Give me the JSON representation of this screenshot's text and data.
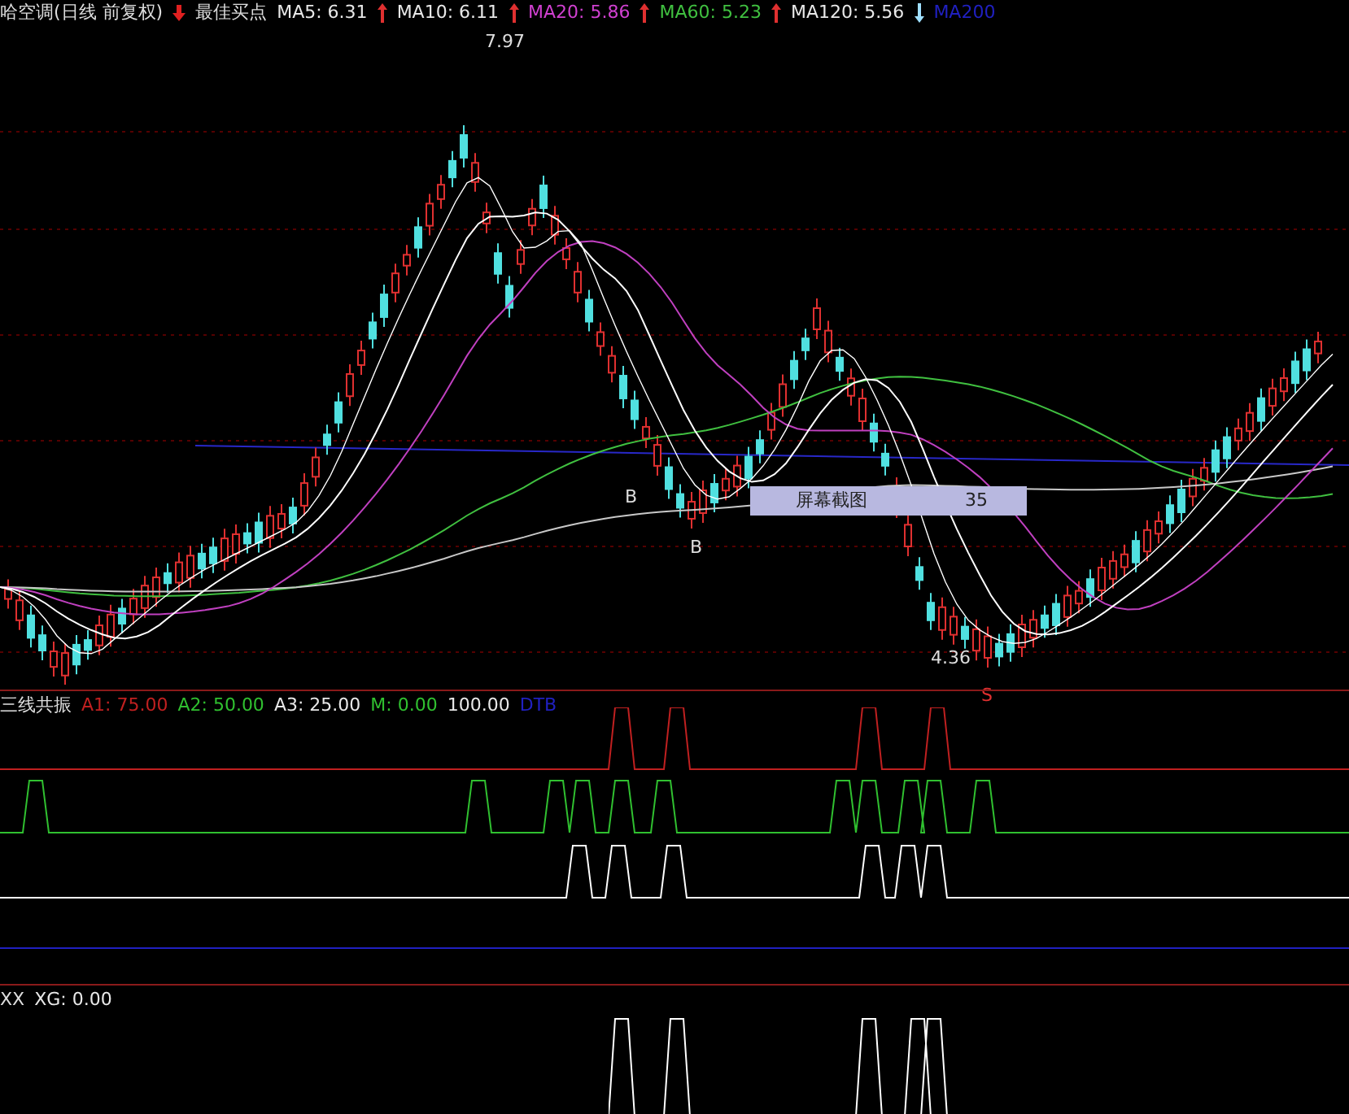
{
  "header": {
    "title": "哈空调(日线 前复权)",
    "signal_label": "最佳买点",
    "indicators": [
      {
        "label": "MA5: 6.31",
        "color": "#e8e8e8",
        "kind": "up"
      },
      {
        "label": "MA10: 6.11",
        "color": "#e8e8e8",
        "kind": "up"
      },
      {
        "label": "MA20: 5.86",
        "color": "#d040d0",
        "kind": "up"
      },
      {
        "label": "MA60: 5.23",
        "color": "#40c040",
        "kind": "up"
      },
      {
        "label": "MA120: 5.56",
        "color": "#e8e8e8",
        "kind": "down"
      },
      {
        "label": "MA200",
        "color": "#2020c0"
      }
    ]
  },
  "price_chart": {
    "high_label": "7.97",
    "low_label": "4.36",
    "markers": [
      {
        "kind": "buy",
        "label": "B"
      },
      {
        "kind": "buy",
        "label": "B"
      },
      {
        "kind": "sell",
        "label": "S"
      }
    ],
    "tooltip": {
      "label": "屏幕截图",
      "value": "35"
    }
  },
  "indicator_panel": {
    "title": "三线共振",
    "values": [
      {
        "label": "A1: 75.00",
        "color": "#c02020"
      },
      {
        "label": "A2: 50.00",
        "color": "#30c030"
      },
      {
        "label": "A3: 25.00",
        "color": "#e8e8e8"
      },
      {
        "label": "M: 0.00",
        "color": "#30c030"
      },
      {
        "label": "100.00",
        "color": "#e8e8e8"
      },
      {
        "label": "DTB",
        "color": "#2020c0"
      }
    ]
  },
  "signal_panel": {
    "title": "XX",
    "values": [
      {
        "label": "XG: 0.00",
        "color": "#e8e8e8"
      }
    ]
  }
}
